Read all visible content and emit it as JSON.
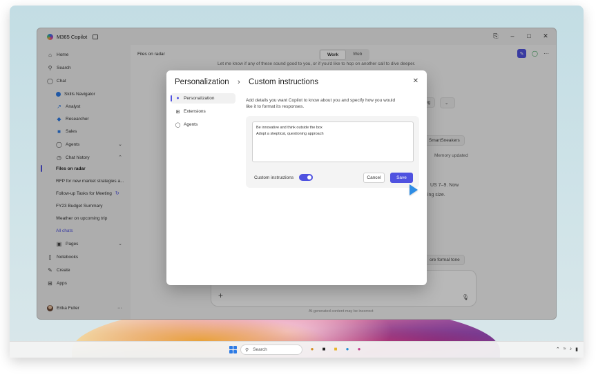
{
  "window": {
    "title": "M365 Copilot"
  },
  "sidebar": {
    "items": [
      {
        "label": "Home",
        "icon": "home-icon"
      },
      {
        "label": "Search",
        "icon": "search-icon"
      },
      {
        "label": "Chat",
        "icon": "chat-icon"
      }
    ],
    "agents": [
      {
        "label": "Skills Navigator",
        "color": "#2d7be5"
      },
      {
        "label": "Analyst",
        "color": "#2d7be5"
      },
      {
        "label": "Researcher",
        "color": "#2d7be5"
      },
      {
        "label": "Sales",
        "color": "#2d7be5"
      }
    ],
    "agents_label": "Agents",
    "chat_history_label": "Chat history",
    "chats": [
      "Files on radar",
      "RFP for new market strategies a...",
      "Follow-up Tasks for Meeting",
      "FY23 Budget Summary",
      "Weather on upcoming trip"
    ],
    "all_chats": "All chats",
    "pages": "Pages",
    "bottom_items": [
      {
        "label": "Notebooks",
        "icon": "notebook-icon"
      },
      {
        "label": "Create",
        "icon": "create-icon"
      },
      {
        "label": "Apps",
        "icon": "apps-icon"
      }
    ],
    "user_name": "Erika Fuller",
    "more": "···"
  },
  "main": {
    "header_title": "Files on radar",
    "tabs": [
      "Work",
      "Web"
    ],
    "bg_line1": "Let me know if any of these sound good to you, or if you'd like to hop on another call to dive deeper.",
    "bg_pill_ng": "ng",
    "bg_pill_smart": "SmartSneakers",
    "bg_memory": "Memory updated",
    "bg_us": "US 7–9. Now",
    "bg_ing": "ing size.",
    "bg_formal": "ore formal tone",
    "disclaimer": "AI-generated content may be incorrect"
  },
  "dialog": {
    "title": "Personalization",
    "subtitle": "Custom instructions",
    "nav": [
      "Personalization",
      "Extensions",
      "Agents"
    ],
    "description": "Add details you want Copilot to know about you and specify how you would like it to format its responses.",
    "instructions_line1": "Be innovative and think outside the box",
    "instructions_line2": "Adopt a skeptical, questioning approach",
    "toggle_label": "Custom instructions",
    "toggle_on": true,
    "cancel": "Cancel",
    "save": "Save"
  },
  "taskbar": {
    "search_placeholder": "Search"
  },
  "colors": {
    "accent": "#4f52e0",
    "cursor": "#2e8de5"
  }
}
